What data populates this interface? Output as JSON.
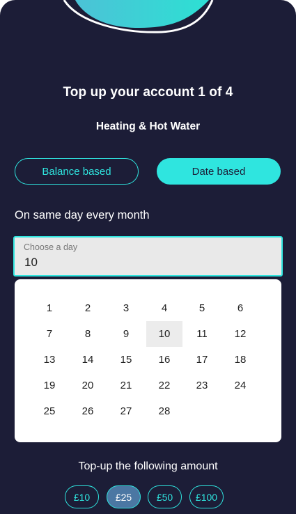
{
  "header": {
    "title": "Top up your account 1 of 4",
    "subtitle": "Heating & Hot Water"
  },
  "mode_toggle": {
    "options": [
      "Balance based",
      "Date based"
    ],
    "selected": "Date based"
  },
  "schedule": {
    "label": "On same day every month",
    "day_field": {
      "placeholder": "Choose a day",
      "value": "10"
    },
    "calendar": {
      "days": [
        "1",
        "2",
        "3",
        "4",
        "5",
        "6",
        "7",
        "8",
        "9",
        "10",
        "11",
        "12",
        "13",
        "14",
        "15",
        "16",
        "17",
        "18",
        "19",
        "20",
        "21",
        "22",
        "23",
        "24",
        "25",
        "26",
        "27",
        "28"
      ],
      "selected": "10"
    }
  },
  "amount": {
    "label": "Top-up the following amount",
    "options": [
      "£10",
      "£25",
      "£50",
      "£100"
    ],
    "selected": "£25"
  },
  "colors": {
    "background": "#1c1d37",
    "accent": "#2fe5df",
    "selected_amount": "#4b77a3"
  }
}
